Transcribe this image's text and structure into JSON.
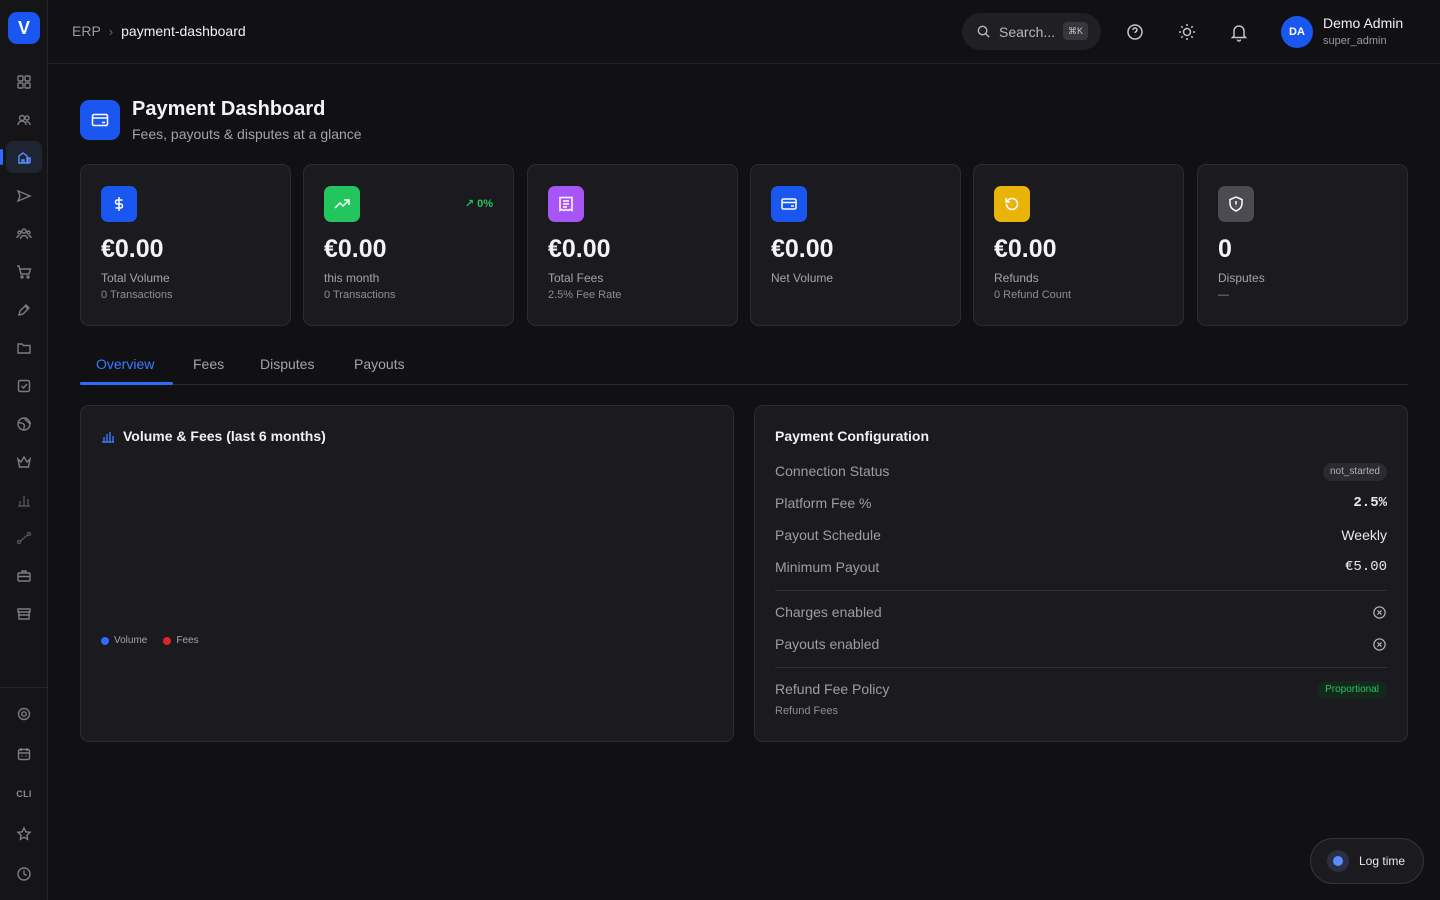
{
  "sidebar": {
    "logo_letter": "V",
    "items": [
      "dashboard-icon",
      "users-icon",
      "finance-icon",
      "send-icon",
      "team-icon",
      "cart-icon",
      "pen-icon",
      "folder-icon",
      "tasks-icon",
      "globe-icon",
      "crown-icon",
      "bars-icon",
      "route-icon",
      "briefcase-icon",
      "store-icon"
    ],
    "footer_items": [
      "settings-icon",
      "calendar-icon",
      "cli-icon",
      "star-icon",
      "clock-icon"
    ],
    "cli_label": "CLI"
  },
  "topbar": {
    "breadcrumb_root": "ERP",
    "breadcrumb_sep": "›",
    "breadcrumb_current": "payment-dashboard",
    "search_label": "Search...",
    "search_shortcut": "⌘K",
    "user_initials": "DA",
    "user_name": "Demo Admin",
    "user_role": "super_admin"
  },
  "header": {
    "title": "Payment Dashboard",
    "subtitle": "Fees, payouts & disputes at a glance"
  },
  "cards": [
    {
      "value": "€0.00",
      "label": "Total Volume",
      "sub": "0 Transactions",
      "color": "#1a56f0",
      "icon": "dollar-icon"
    },
    {
      "value": "€0.00",
      "label": "this month",
      "sub": "0 Transactions",
      "color": "#22c55e",
      "icon": "trending-up-icon",
      "trend": "↗ 0%"
    },
    {
      "value": "€0.00",
      "label": "Total Fees",
      "sub": "2.5% Fee Rate",
      "color": "#a855f7",
      "icon": "receipt-icon"
    },
    {
      "value": "€0.00",
      "label": "Net Volume",
      "sub": "",
      "color": "#1a56f0",
      "icon": "card-icon"
    },
    {
      "value": "€0.00",
      "label": "Refunds",
      "sub": "0 Refund Count",
      "color": "#eab308",
      "icon": "refund-icon"
    },
    {
      "value": "0",
      "label": "Disputes",
      "sub": "—",
      "color": "#4b4b52",
      "icon": "shield-icon"
    }
  ],
  "tabs": [
    "Overview",
    "Fees",
    "Disputes",
    "Payouts"
  ],
  "chart_panel": {
    "title": "Volume & Fees (last 6 months)",
    "legend_volume": "Volume",
    "legend_fees": "Fees",
    "volume_color": "#2f6bff",
    "fees_color": "#dc2626"
  },
  "chart_data": {
    "type": "bar",
    "title": "Volume & Fees (last 6 months)",
    "categories": [],
    "series": [
      {
        "name": "Volume",
        "values": []
      },
      {
        "name": "Fees",
        "values": []
      }
    ]
  },
  "config": {
    "title": "Payment Configuration",
    "connection_status_label": "Connection Status",
    "connection_status_value": "not_started",
    "platform_fee_label": "Platform Fee %",
    "platform_fee_value": "2.5%",
    "payout_schedule_label": "Payout Schedule",
    "payout_schedule_value": "Weekly",
    "minimum_payout_label": "Minimum Payout",
    "minimum_payout_value": "€5.00",
    "charges_enabled_label": "Charges enabled",
    "payouts_enabled_label": "Payouts enabled",
    "refund_fee_policy_label": "Refund Fee Policy",
    "refund_fee_policy_value": "Proportional",
    "refund_fee_sub": "Refund Fees"
  },
  "log_time": {
    "label": "Log time"
  }
}
